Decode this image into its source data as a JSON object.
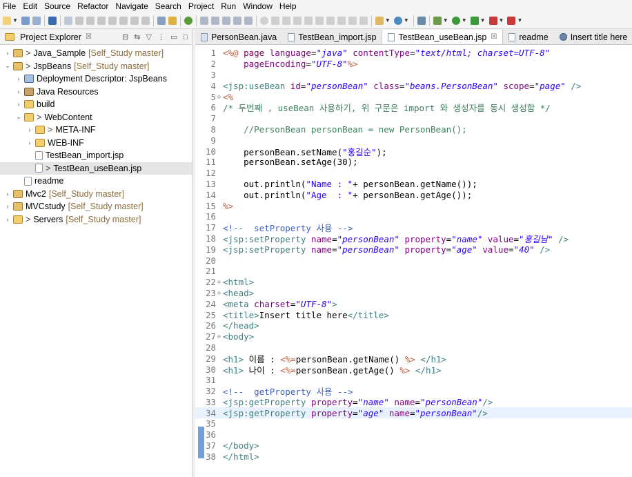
{
  "menu": [
    "File",
    "Edit",
    "Source",
    "Refactor",
    "Navigate",
    "Search",
    "Project",
    "Run",
    "Window",
    "Help"
  ],
  "explorer": {
    "title": "Project Explorer",
    "close": "☒",
    "nodes": [
      {
        "label": "Java_Sample",
        "repo": "[Self_Study master]",
        "prefix": ">",
        "twisty": "›",
        "icon": "proj",
        "indent": 0
      },
      {
        "label": "JspBeans",
        "repo": "[Self_Study master]",
        "prefix": ">",
        "twisty": "⌄",
        "icon": "proj",
        "indent": 0
      },
      {
        "label": "Deployment Descriptor: JspBeans",
        "repo": "",
        "prefix": "",
        "twisty": "›",
        "icon": "desc",
        "indent": 1
      },
      {
        "label": "Java Resources",
        "repo": "",
        "prefix": "",
        "twisty": "›",
        "icon": "lib",
        "indent": 1
      },
      {
        "label": "build",
        "repo": "",
        "prefix": "",
        "twisty": "›",
        "icon": "folder",
        "indent": 1
      },
      {
        "label": "WebContent",
        "repo": "",
        "prefix": ">",
        "twisty": "⌄",
        "icon": "folder",
        "indent": 1
      },
      {
        "label": "META-INF",
        "repo": "",
        "prefix": ">",
        "twisty": "›",
        "icon": "folder",
        "indent": 2
      },
      {
        "label": "WEB-INF",
        "repo": "",
        "prefix": "",
        "twisty": "›",
        "icon": "folder",
        "indent": 2
      },
      {
        "label": "TestBean_import.jsp",
        "repo": "",
        "prefix": "",
        "twisty": "",
        "icon": "file",
        "indent": 2
      },
      {
        "label": "TestBean_useBean.jsp",
        "repo": "",
        "prefix": ">",
        "twisty": "",
        "icon": "file",
        "indent": 2,
        "selected": true
      },
      {
        "label": "readme",
        "repo": "",
        "prefix": "",
        "twisty": "",
        "icon": "file",
        "indent": 1
      },
      {
        "label": "Mvc2",
        "repo": "[Self_Study master]",
        "prefix": "",
        "twisty": "›",
        "icon": "proj",
        "indent": 0
      },
      {
        "label": "MVCstudy",
        "repo": "[Self_Study master]",
        "prefix": "",
        "twisty": "›",
        "icon": "proj",
        "indent": 0
      },
      {
        "label": "Servers",
        "repo": "[Self_Study master]",
        "prefix": ">",
        "twisty": "›",
        "icon": "folder",
        "indent": 0
      }
    ]
  },
  "editor": {
    "tabs": [
      {
        "label": "PersonBean.java",
        "icon": "java",
        "active": false
      },
      {
        "label": "TestBean_import.jsp",
        "icon": "file",
        "active": false
      },
      {
        "label": "TestBean_useBean.jsp",
        "icon": "file",
        "active": true,
        "close": "☒"
      },
      {
        "label": "readme",
        "icon": "file",
        "active": false
      },
      {
        "label": "Insert title here",
        "icon": "web",
        "active": false
      }
    ],
    "current_line": 34,
    "lines": [
      {
        "n": 1,
        "fold": "",
        "html": "<span class='d'>&lt;%@</span> <span class='k'>page</span> <span class='a'>language</span>=<span class='s'>\"java\"</span> <span class='a'>contentType</span>=<span class='s'>\"text/html; charset=UTF-8\"</span>"
      },
      {
        "n": 2,
        "fold": "",
        "html": "    <span class='a'>pageEncoding</span>=<span class='s'>\"UTF-8\"</span><span class='d'>%&gt;</span>"
      },
      {
        "n": 3,
        "fold": "",
        "html": ""
      },
      {
        "n": 4,
        "fold": "",
        "html": "<span class='t'>&lt;jsp:useBean</span> <span class='a'>id</span>=<span class='s'>\"personBean\"</span> <span class='a'>class</span>=<span class='s'>\"beans.PersonBean\"</span> <span class='a'>scope</span>=<span class='s'>\"page\"</span> <span class='t'>/&gt;</span>"
      },
      {
        "n": 5,
        "fold": "⊖",
        "html": "<span class='d'>&lt;%</span>"
      },
      {
        "n": 6,
        "fold": "",
        "html": "<span class='cm'>/* 두번째 , useBean 사용하기, 위 구문은 import 와 생성자를 동시 생성함 */</span>"
      },
      {
        "n": 7,
        "fold": "",
        "html": ""
      },
      {
        "n": 8,
        "fold": "",
        "html": "    <span class='cm'>//PersonBean personBean = new PersonBean();</span>"
      },
      {
        "n": 9,
        "fold": "",
        "html": ""
      },
      {
        "n": 10,
        "fold": "",
        "html": "    personBean.setName(<span class='sq'>\"홍길순\"</span>);"
      },
      {
        "n": 11,
        "fold": "",
        "html": "    personBean.setAge(30);"
      },
      {
        "n": 12,
        "fold": "",
        "html": ""
      },
      {
        "n": 13,
        "fold": "",
        "html": "    out.println(<span class='sq'>\"Name : \"</span>+ personBean.getName());"
      },
      {
        "n": 14,
        "fold": "",
        "html": "    out.println(<span class='sq'>\"Age  : \"</span>+ personBean.getAge());"
      },
      {
        "n": 15,
        "fold": "",
        "html": "<span class='d'>%&gt;</span>"
      },
      {
        "n": 16,
        "fold": "",
        "html": ""
      },
      {
        "n": 17,
        "fold": "",
        "html": "<span class='c'>&lt;!--  setProperty 사용 --&gt;</span>"
      },
      {
        "n": 18,
        "fold": "",
        "html": "<span class='t'>&lt;jsp:setProperty</span> <span class='a'>name</span>=<span class='s'>\"personBean\"</span> <span class='a'>property</span>=<span class='s'>\"name\"</span> <span class='a'>value</span>=<span class='s'>\"홍길남\"</span> <span class='t'>/&gt;</span>"
      },
      {
        "n": 19,
        "fold": "",
        "html": "<span class='t'>&lt;jsp:setProperty</span> <span class='a'>name</span>=<span class='s'>\"personBean\"</span> <span class='a'>property</span>=<span class='s'>\"age\"</span> <span class='a'>value</span>=<span class='s'>\"40\"</span> <span class='t'>/&gt;</span>"
      },
      {
        "n": 20,
        "fold": "",
        "html": ""
      },
      {
        "n": 21,
        "fold": "",
        "html": ""
      },
      {
        "n": 22,
        "fold": "⊖",
        "html": "<span class='t'>&lt;html&gt;</span>"
      },
      {
        "n": 23,
        "fold": "⊖",
        "html": "<span class='t'>&lt;head&gt;</span>"
      },
      {
        "n": 24,
        "fold": "",
        "html": "<span class='t'>&lt;meta</span> <span class='a'>charset</span>=<span class='s'>\"UTF-8\"</span><span class='t'>&gt;</span>"
      },
      {
        "n": 25,
        "fold": "",
        "html": "<span class='t'>&lt;title&gt;</span>Insert title here<span class='t'>&lt;/title&gt;</span>"
      },
      {
        "n": 26,
        "fold": "",
        "html": "<span class='t'>&lt;/head&gt;</span>"
      },
      {
        "n": 27,
        "fold": "⊖",
        "html": "<span class='t'>&lt;body&gt;</span>"
      },
      {
        "n": 28,
        "fold": "",
        "html": ""
      },
      {
        "n": 29,
        "fold": "",
        "html": "<span class='t'>&lt;h1&gt;</span> 이름 : <span class='d'>&lt;%=</span>personBean.getName() <span class='d'>%&gt;</span> <span class='t'>&lt;/h1&gt;</span>"
      },
      {
        "n": 30,
        "fold": "",
        "html": "<span class='t'>&lt;h1&gt;</span> 나이 : <span class='d'>&lt;%=</span>personBean.getAge() <span class='d'>%&gt;</span> <span class='t'>&lt;/h1&gt;</span>"
      },
      {
        "n": 31,
        "fold": "",
        "html": ""
      },
      {
        "n": 32,
        "fold": "",
        "html": "<span class='c'>&lt;!--  getProperty 사용 --&gt;</span>"
      },
      {
        "n": 33,
        "fold": "",
        "html": "<span class='t'>&lt;jsp:getProperty</span> <span class='a'>property</span>=<span class='s'>\"name\"</span> <span class='a'>name</span>=<span class='s'>\"personBean\"</span><span class='t'>/&gt;</span>"
      },
      {
        "n": 34,
        "fold": "",
        "html": "<span class='t'>&lt;jsp:getProperty</span> <span class='a'>property</span>=<span class='s'>\"age\"</span> <span class='a'>name</span>=<span class='s'>\"personBean\"</span><span class='t'>/&gt;</span>"
      },
      {
        "n": 35,
        "fold": "",
        "html": ""
      },
      {
        "n": 36,
        "fold": "",
        "html": ""
      },
      {
        "n": 37,
        "fold": "",
        "html": "<span class='t'>&lt;/body&gt;</span>"
      },
      {
        "n": 38,
        "fold": "",
        "html": "<span class='t'>&lt;/html&gt;</span>"
      }
    ]
  },
  "colors": {
    "accent": "#6fa0d8",
    "keyword": "#7f0055",
    "string": "#2a00ff",
    "tag": "#3f7f7f",
    "attr": "#7f007f",
    "comment": "#3f5fbf"
  }
}
